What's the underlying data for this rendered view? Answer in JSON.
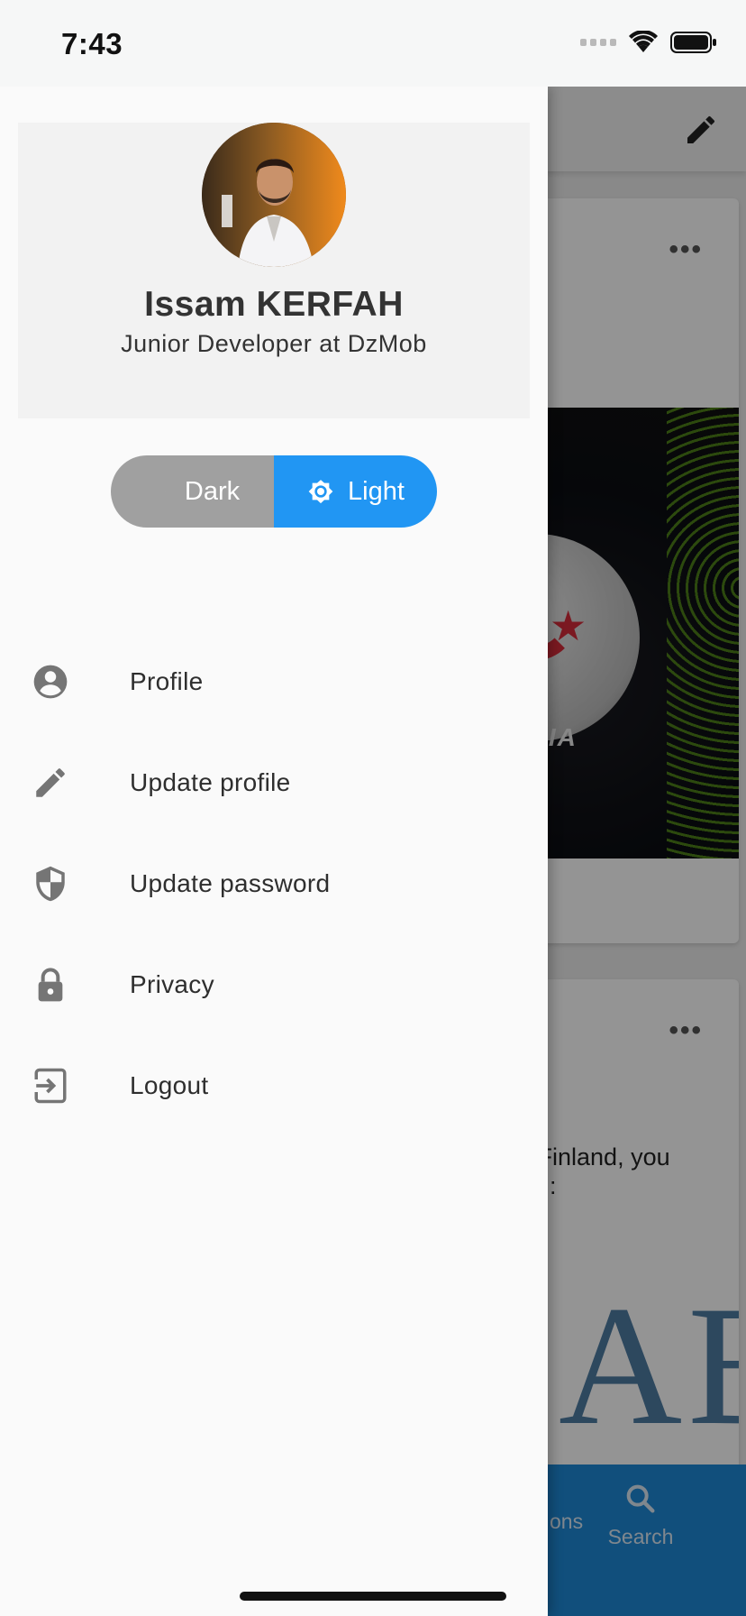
{
  "status_bar": {
    "time": "7:43"
  },
  "drawer": {
    "user": {
      "name": "Issam KERFAH",
      "title": "Junior Developer at DzMob"
    },
    "theme_toggle": {
      "dark_label": "Dark",
      "light_label": "Light",
      "selected": "Light"
    },
    "menu": [
      {
        "label": "Profile",
        "icon": "account-circle-icon"
      },
      {
        "label": "Update profile",
        "icon": "pencil-icon"
      },
      {
        "label": "Update password",
        "icon": "shield-icon"
      },
      {
        "label": "Privacy",
        "icon": "lock-icon"
      },
      {
        "label": "Logout",
        "icon": "logout-icon"
      }
    ]
  },
  "background": {
    "image_word": "ERIA",
    "post_text_line1": "d Finland, you",
    "post_text_line2": "ite :",
    "big_letters": "AB",
    "nav_partial_label": "ons",
    "nav_search_label": "Search"
  },
  "colors": {
    "accent": "#2196f3",
    "toggle_inactive": "#a0a0a0",
    "nav": "#1e88d6"
  }
}
